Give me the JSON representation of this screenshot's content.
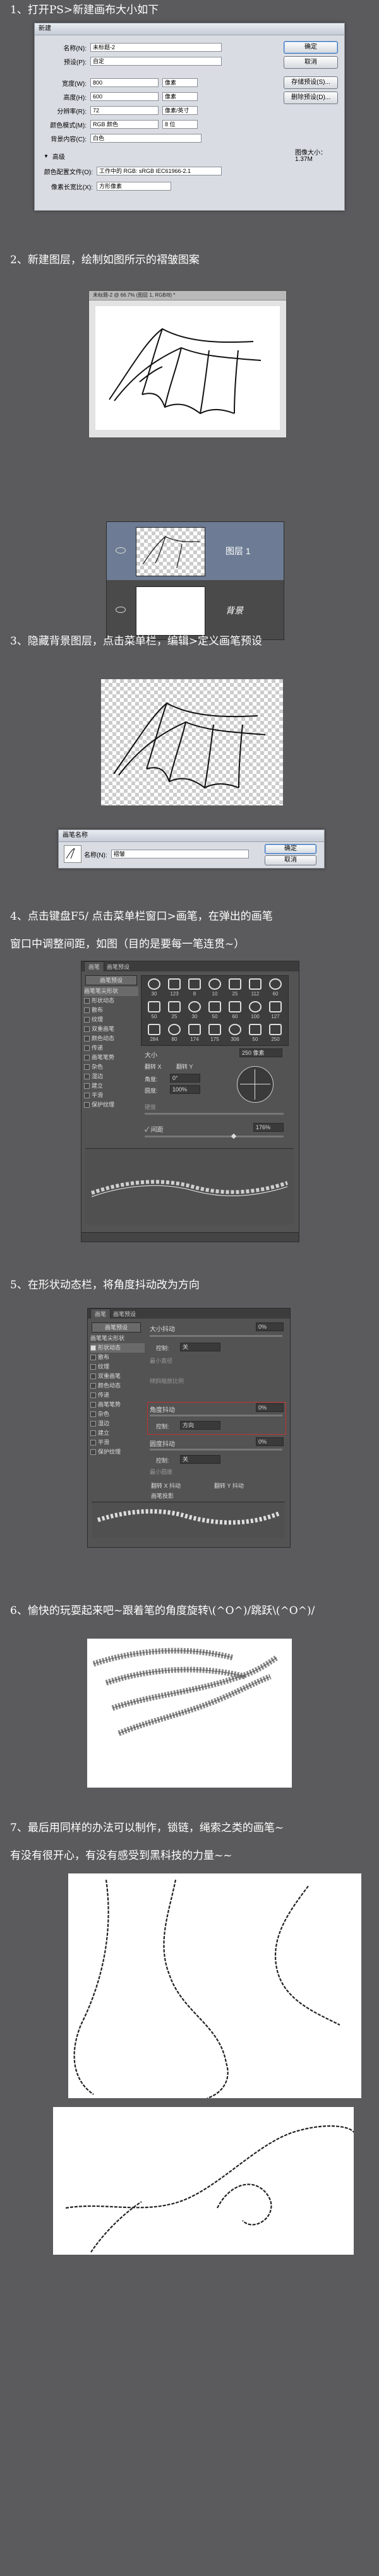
{
  "steps": [
    "1、打开PS>新建画布大小如下",
    "2、新建图层，绘制如图所示的褶皱图案",
    "3、隐藏背景图层，点击菜单栏，编辑>定义画笔预设",
    "4、点击键盘F5/ 点击菜单栏窗口>画笔，在弹出的画笔",
    "窗口中调整间距，如图（目的是要每一笔连贯~）",
    "5、在形状动态栏，将角度抖动改为方向",
    "6、愉快的玩耍起来吧~跟着笔的角度旋转\\(^O^)/跳跃\\(^O^)/",
    "7、最后用同样的办法可以制作，锁链，绳索之类的画笔~",
    "有没有很开心，有没有感受到黑科技的力量~~"
  ],
  "new_dialog": {
    "title": "新建",
    "fields": [
      {
        "label": "名称(N):",
        "value": "未标题-2"
      },
      {
        "label": "预设(P):",
        "value": "自定"
      },
      {
        "label": "宽度(W):",
        "value": "800",
        "unit": "像素"
      },
      {
        "label": "高度(H):",
        "value": "600",
        "unit": "像素"
      },
      {
        "label": "分辨率(R):",
        "value": "72",
        "unit": "像素/英寸"
      },
      {
        "label": "颜色模式(M):",
        "value": "RGB 颜色",
        "unit": "8 位"
      },
      {
        "label": "背景内容(C):",
        "value": "白色"
      }
    ],
    "advanced_label": "高级",
    "profile_label": "颜色配置文件(O):",
    "profile_value": "工作中的 RGB: sRGB IEC61966-2.1",
    "aspect_label": "像素长宽比(X):",
    "aspect_value": "方形像素",
    "buttons": [
      "确定",
      "取消",
      "存储预设(S)...",
      "删除预设(D)..."
    ],
    "size_label": "图像大小：",
    "size_value": "1.37M"
  },
  "doc_window": {
    "tab": "未标题-2 @ 66.7% (图层 1, RGB/8) *"
  },
  "layers": [
    {
      "name": "图层 1",
      "selected": true
    },
    {
      "name": "背景",
      "selected": false
    }
  ],
  "brush_name_dialog": {
    "title": "画笔名称",
    "label": "名称(N):",
    "value": "褶皱",
    "buttons": [
      "确定",
      "取消"
    ]
  },
  "brush_panel": {
    "tabs": [
      "画笔",
      "画笔预设"
    ],
    "preset_button": "画笔预设",
    "items": [
      "画笔笔尖形状",
      "形状动态",
      "散布",
      "纹理",
      "双重画笔",
      "颜色动态",
      "传递",
      "画笔笔势",
      "杂色",
      "湿边",
      "建立",
      "平滑",
      "保护纹理"
    ],
    "size_label": "大小",
    "size_value": "250 像素",
    "flip_x": "翻转 X",
    "flip_y": "翻转 Y",
    "angle_label": "角度:",
    "angle_value": "0°",
    "roundness_label": "圆度:",
    "roundness_value": "100%",
    "hardness_label": "硬度",
    "spacing_label": "间距",
    "spacing_value": "176%",
    "tip_sizes": [
      "30",
      "123",
      "8",
      "10",
      "25",
      "112",
      "60",
      "50",
      "25",
      "30",
      "50",
      "60",
      "100",
      "127",
      "284",
      "80",
      "174",
      "175",
      "306",
      "50",
      "250"
    ]
  },
  "shape_panel": {
    "tabs": [
      "画笔",
      "画笔预设"
    ],
    "preset_button": "画笔预设",
    "items": [
      "画笔笔尖形状",
      "形状动态",
      "散布",
      "纹理",
      "双重画笔",
      "颜色动态",
      "传递",
      "画笔笔势",
      "杂色",
      "湿边",
      "建立",
      "平滑",
      "保护纹理"
    ],
    "size_jitter_label": "大小抖动",
    "size_jitter_value": "0%",
    "control_label": "控制:",
    "control_off": "关",
    "min_diameter_label": "最小直径",
    "tilt_scale_label": "倾斜缩放比例",
    "angle_jitter_label": "角度抖动",
    "angle_jitter_value": "0%",
    "control_direction": "方向",
    "roundness_jitter_label": "圆度抖动",
    "roundness_jitter_value": "0%",
    "min_roundness_label": "最小圆度",
    "flip_x_jitter": "翻转 X 抖动",
    "flip_y_jitter": "翻转 Y 抖动",
    "projection": "画笔投影"
  },
  "colors": {
    "bg": "#5b5b5d",
    "dialog": "#d9dde3",
    "panel": "#535353",
    "highlight": "#c43030"
  }
}
